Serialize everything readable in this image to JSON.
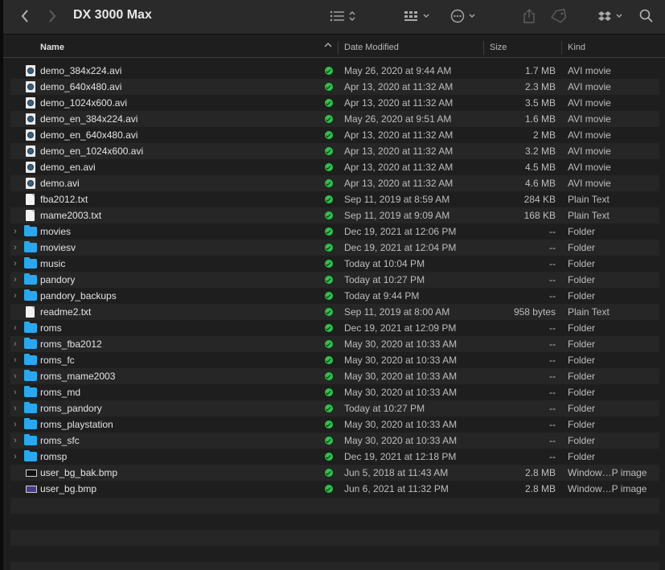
{
  "window": {
    "title": "DX 3000 Max"
  },
  "toolbar": {
    "back_icon": "chevron-left-icon",
    "forward_icon": "chevron-right-icon",
    "view_icon": "list-view-icon",
    "group_icon": "grid-icon",
    "action_icon": "ellipsis-icon",
    "share_icon": "share-icon",
    "tag_icon": "tag-icon",
    "dropbox_icon": "dropbox-icon",
    "search_icon": "search-icon"
  },
  "columns": {
    "name": "Name",
    "date": "Date Modified",
    "size": "Size",
    "kind": "Kind"
  },
  "files": [
    {
      "name": "demo_384x224.avi",
      "date": "May 26, 2020 at 9:44 AM",
      "size": "1.7 MB",
      "kind": "AVI movie",
      "type": "movie"
    },
    {
      "name": "demo_640x480.avi",
      "date": "Apr 13, 2020 at 11:32 AM",
      "size": "2.3 MB",
      "kind": "AVI movie",
      "type": "movie"
    },
    {
      "name": "demo_1024x600.avi",
      "date": "Apr 13, 2020 at 11:32 AM",
      "size": "3.5 MB",
      "kind": "AVI movie",
      "type": "movie"
    },
    {
      "name": "demo_en_384x224.avi",
      "date": "May 26, 2020 at 9:51 AM",
      "size": "1.6 MB",
      "kind": "AVI movie",
      "type": "movie"
    },
    {
      "name": "demo_en_640x480.avi",
      "date": "Apr 13, 2020 at 11:32 AM",
      "size": "2 MB",
      "kind": "AVI movie",
      "type": "movie"
    },
    {
      "name": "demo_en_1024x600.avi",
      "date": "Apr 13, 2020 at 11:32 AM",
      "size": "3.2 MB",
      "kind": "AVI movie",
      "type": "movie"
    },
    {
      "name": "demo_en.avi",
      "date": "Apr 13, 2020 at 11:32 AM",
      "size": "4.5 MB",
      "kind": "AVI movie",
      "type": "movie"
    },
    {
      "name": "demo.avi",
      "date": "Apr 13, 2020 at 11:32 AM",
      "size": "4.6 MB",
      "kind": "AVI movie",
      "type": "movie"
    },
    {
      "name": "fba2012.txt",
      "date": "Sep 11, 2019 at 8:59 AM",
      "size": "284 KB",
      "kind": "Plain Text",
      "type": "text"
    },
    {
      "name": "mame2003.txt",
      "date": "Sep 11, 2019 at 9:09 AM",
      "size": "168 KB",
      "kind": "Plain Text",
      "type": "text"
    },
    {
      "name": "movies",
      "date": "Dec 19, 2021 at 12:06 PM",
      "size": "--",
      "kind": "Folder",
      "type": "folder"
    },
    {
      "name": "moviesv",
      "date": "Dec 19, 2021 at 12:04 PM",
      "size": "--",
      "kind": "Folder",
      "type": "folder"
    },
    {
      "name": "music",
      "date": "Today at 10:04 PM",
      "size": "--",
      "kind": "Folder",
      "type": "folder"
    },
    {
      "name": "pandory",
      "date": "Today at 10:27 PM",
      "size": "--",
      "kind": "Folder",
      "type": "folder"
    },
    {
      "name": "pandory_backups",
      "date": "Today at 9:44 PM",
      "size": "--",
      "kind": "Folder",
      "type": "folder"
    },
    {
      "name": "readme2.txt",
      "date": "Sep 11, 2019 at 8:00 AM",
      "size": "958 bytes",
      "kind": "Plain Text",
      "type": "text"
    },
    {
      "name": "roms",
      "date": "Dec 19, 2021 at 12:09 PM",
      "size": "--",
      "kind": "Folder",
      "type": "folder"
    },
    {
      "name": "roms_fba2012",
      "date": "May 30, 2020 at 10:33 AM",
      "size": "--",
      "kind": "Folder",
      "type": "folder"
    },
    {
      "name": "roms_fc",
      "date": "May 30, 2020 at 10:33 AM",
      "size": "--",
      "kind": "Folder",
      "type": "folder"
    },
    {
      "name": "roms_mame2003",
      "date": "May 30, 2020 at 10:33 AM",
      "size": "--",
      "kind": "Folder",
      "type": "folder"
    },
    {
      "name": "roms_md",
      "date": "May 30, 2020 at 10:33 AM",
      "size": "--",
      "kind": "Folder",
      "type": "folder"
    },
    {
      "name": "roms_pandory",
      "date": "Today at 10:27 PM",
      "size": "--",
      "kind": "Folder",
      "type": "folder"
    },
    {
      "name": "roms_playstation",
      "date": "May 30, 2020 at 10:33 AM",
      "size": "--",
      "kind": "Folder",
      "type": "folder"
    },
    {
      "name": "roms_sfc",
      "date": "May 30, 2020 at 10:33 AM",
      "size": "--",
      "kind": "Folder",
      "type": "folder"
    },
    {
      "name": "romsp",
      "date": "Dec 19, 2021 at 12:18 PM",
      "size": "--",
      "kind": "Folder",
      "type": "folder"
    },
    {
      "name": "user_bg_bak.bmp",
      "date": "Jun 5, 2018 at 11:43 AM",
      "size": "2.8 MB",
      "kind": "Window…P image",
      "type": "bmp"
    },
    {
      "name": "user_bg.bmp",
      "date": "Jun 6, 2021 at 11:32 PM",
      "size": "2.8 MB",
      "kind": "Window…P image",
      "type": "bmp2"
    }
  ],
  "colors": {
    "folder": "#29a8f0",
    "synced": "#32c04a",
    "background": "#1e1e1e"
  }
}
